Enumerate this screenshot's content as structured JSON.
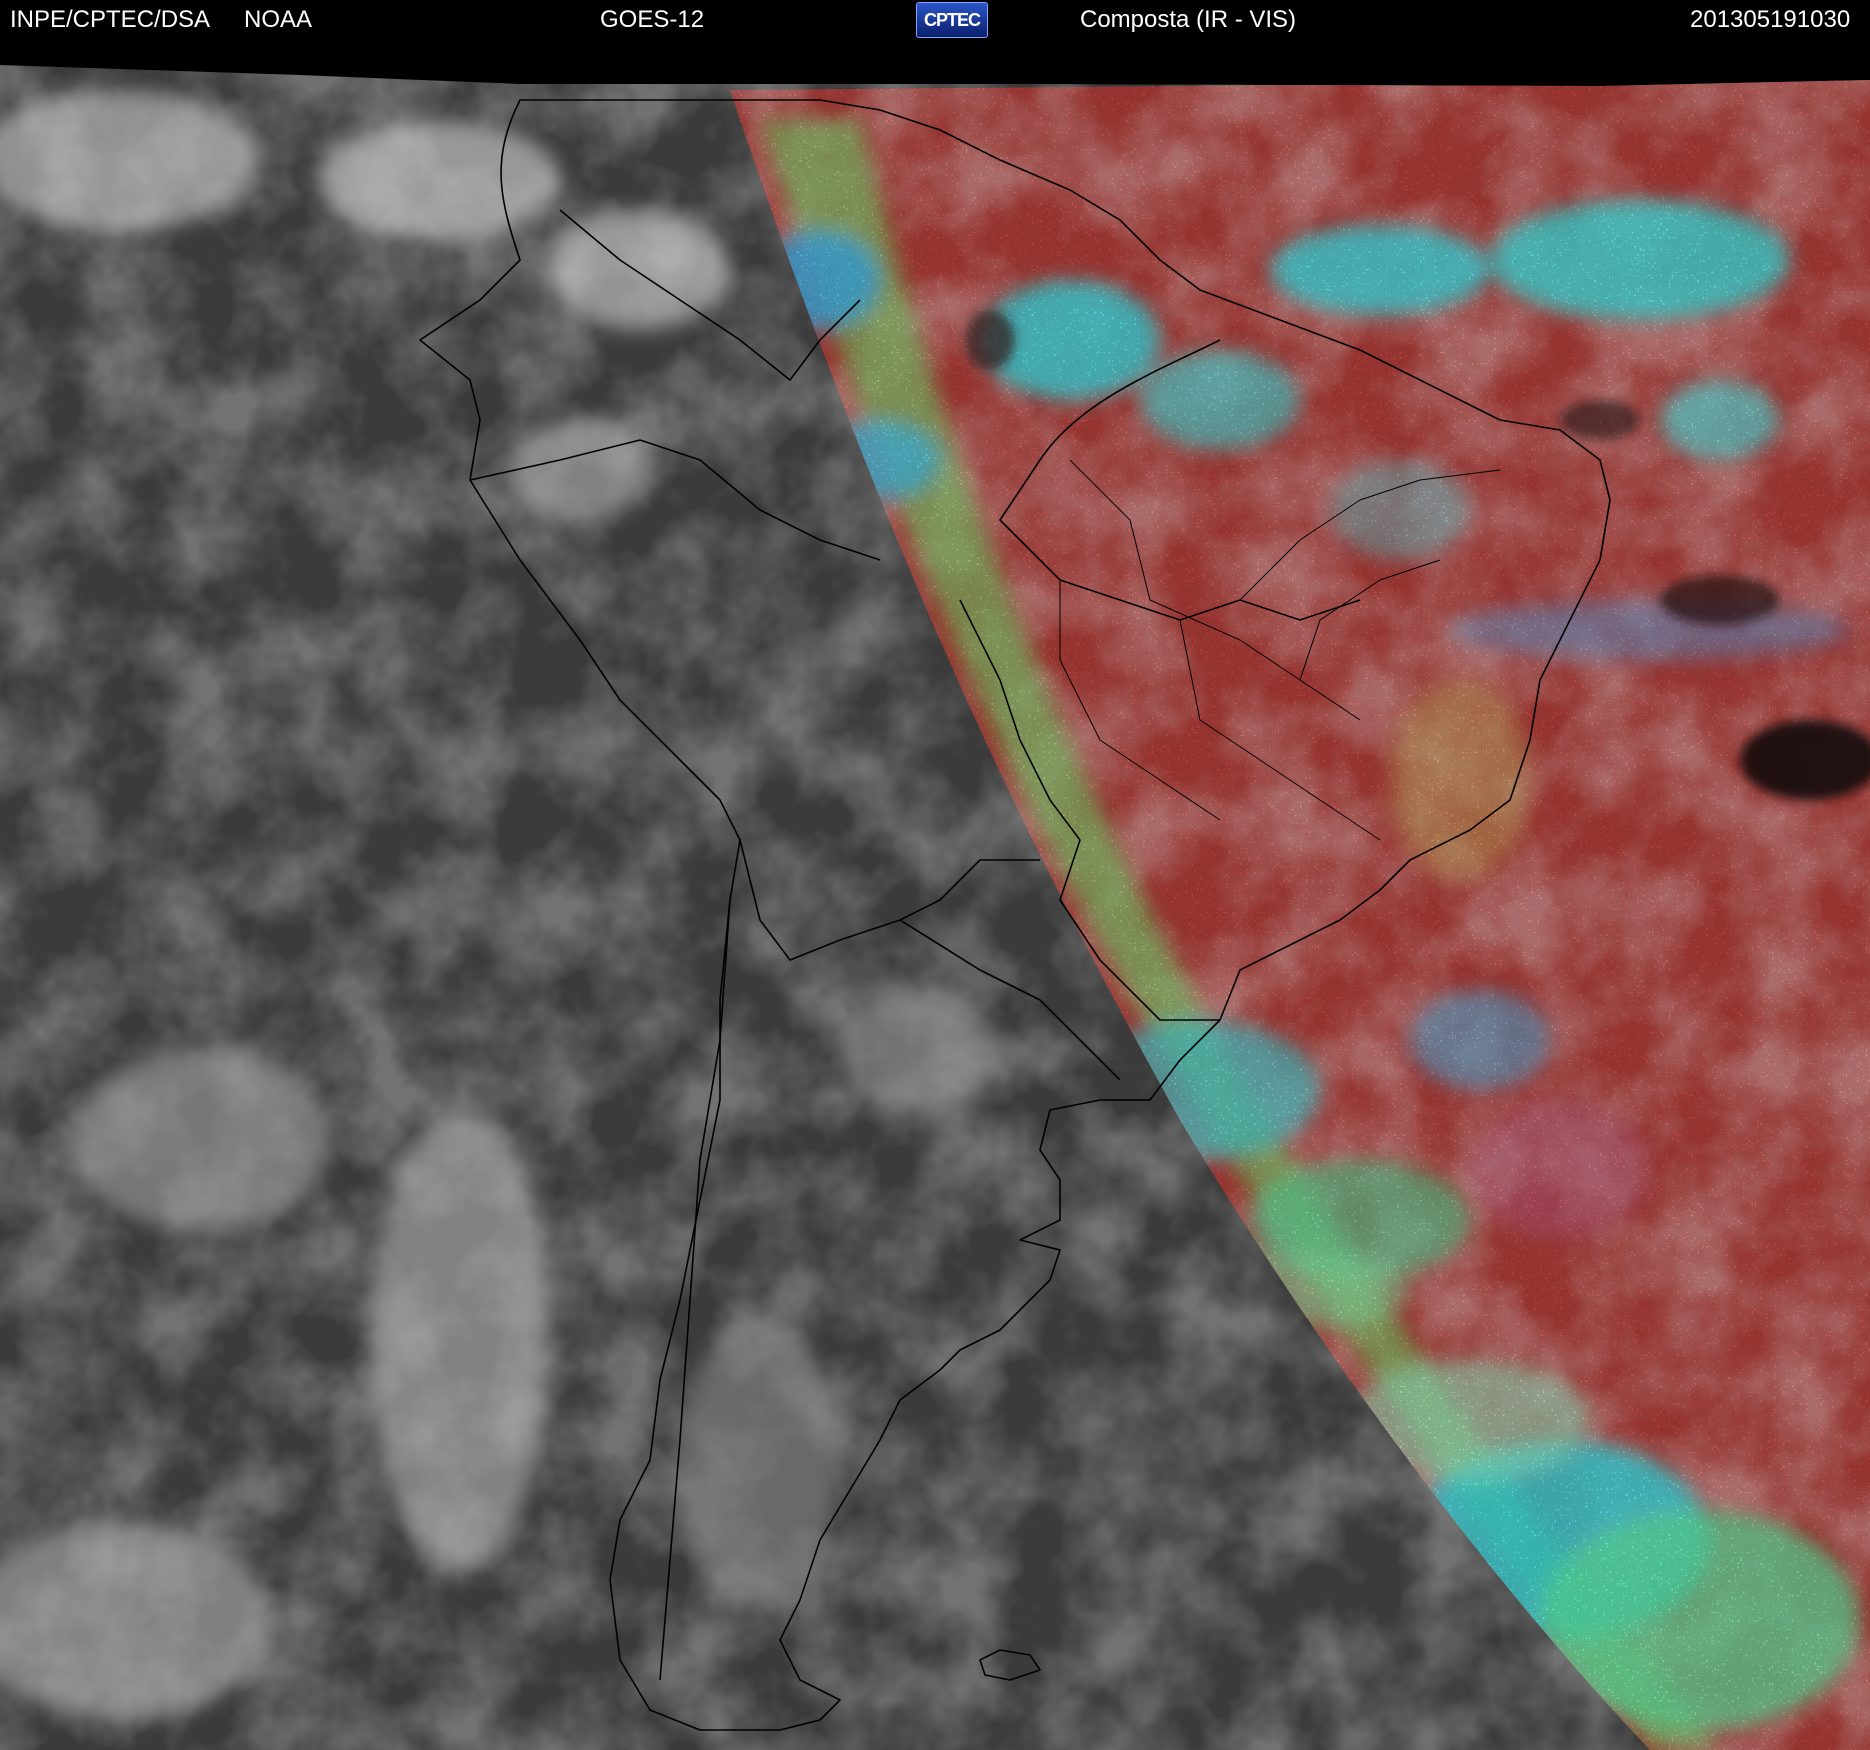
{
  "header": {
    "institution": "INPE/CPTEC/DSA",
    "agency": "NOAA",
    "satellite": "GOES-12",
    "logo_text": "CPTEC",
    "product": "Composta (IR - VIS)",
    "timestamp": "201305191030"
  },
  "colors": {
    "background": "#000000",
    "ir_gray": "#3a3a3a",
    "vis_red": "#b5403c",
    "cloud_cyan": "#33e6f0",
    "cloud_green": "#60e890",
    "cloud_white": "#dcdcdc",
    "border_line": "#000000"
  }
}
